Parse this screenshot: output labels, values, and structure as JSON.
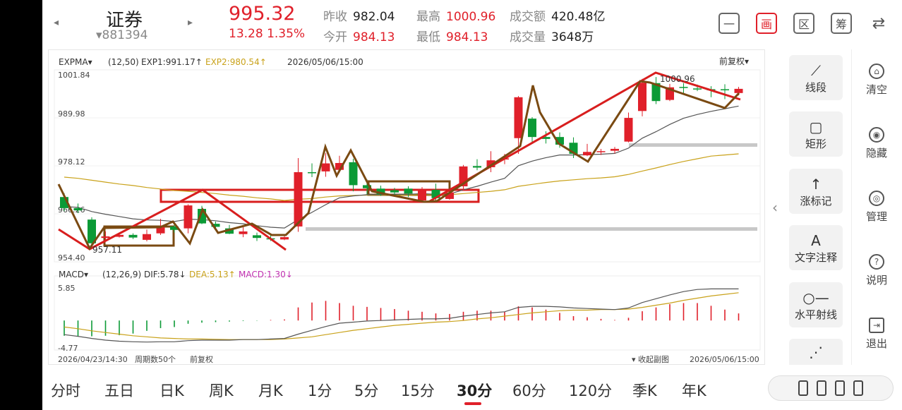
{
  "header": {
    "prev_arrow": "◂",
    "next_arrow": "▸",
    "name": "证券",
    "code": "▾881394",
    "price": "995.32",
    "change": "13.28  1.35%",
    "quotes": [
      {
        "label": "昨收",
        "value": "982.04",
        "color": "dark"
      },
      {
        "label": "最高",
        "value": "1000.96",
        "color": "red"
      },
      {
        "label": "成交额",
        "value": "420.48亿",
        "color": "dark"
      },
      {
        "label": "今开",
        "value": "984.13",
        "color": "red"
      },
      {
        "label": "最低",
        "value": "984.13",
        "color": "red"
      },
      {
        "label": "成交量",
        "value": "3648万",
        "color": "dark"
      }
    ],
    "tools": [
      {
        "icon": "minus-box-icon",
        "glyph": "一"
      },
      {
        "icon": "draw-icon",
        "glyph": "画"
      },
      {
        "icon": "range-icon",
        "glyph": "区"
      },
      {
        "icon": "chips-icon",
        "glyph": "筹"
      },
      {
        "icon": "rotate-phone-icon",
        "glyph": "⇄"
      }
    ]
  },
  "main_chart": {
    "indicator": "EXPMA▾",
    "params": "(12,50)",
    "exp1": "EXP1:991.17↑",
    "exp2": "EXP2:980.54↑",
    "datetime": "2026/05/06/15:00",
    "adjust": "前复权▾",
    "ticks": [
      "1001.84",
      "989.98",
      "978.12",
      "966.26",
      "954.40"
    ],
    "high_label": "1000.96",
    "low_label": "957.11"
  },
  "macd": {
    "indicator": "MACD▾",
    "params": "(12,26,9)",
    "dif": "DIF:5.78↓",
    "dea": "DEA:5.13↑",
    "macd": "MACD:1.30↓",
    "top": "5.85",
    "bottom": "-4.77"
  },
  "footer": {
    "start": "2026/04/23/14:30",
    "count": "周期数50个",
    "adjust": "前复权",
    "collapse": "▾ 收起副图",
    "end": "2026/05/06/15:00"
  },
  "colors": {
    "up": "#e0202a",
    "down": "#0b9a36",
    "exp1": "#555555",
    "exp2": "#c9a21a",
    "trend_brown": "#7a4a12"
  },
  "right_panel": {
    "collapse": "‹",
    "draw_tools": [
      {
        "icon": "segment-icon",
        "glyph": "⟋",
        "label": "线段"
      },
      {
        "icon": "rectangle-icon",
        "glyph": "▢",
        "label": "矩形"
      },
      {
        "icon": "up-mark-icon",
        "glyph": "↑",
        "label": "涨标记"
      },
      {
        "icon": "text-icon",
        "glyph": "A",
        "label": "文字注释"
      },
      {
        "icon": "ray-icon",
        "glyph": "○—",
        "label": "水平射线"
      },
      {
        "icon": "more-icon",
        "glyph": "⋰",
        "label": ""
      }
    ],
    "side_tools": [
      {
        "icon": "trash-icon",
        "glyph": "⌂",
        "label": "清空"
      },
      {
        "icon": "eye-icon",
        "glyph": "◉",
        "label": "隐藏"
      },
      {
        "icon": "settings-icon",
        "glyph": "◎",
        "label": "管理"
      },
      {
        "icon": "help-icon",
        "glyph": "?",
        "label": "说明"
      },
      {
        "icon": "exit-icon",
        "glyph": "⇥",
        "label": "退出"
      }
    ]
  },
  "periods": [
    "分时",
    "五日",
    "日K",
    "周K",
    "月K",
    "1分",
    "5分",
    "15分",
    "30分",
    "60分",
    "120分",
    "季K",
    "年K"
  ],
  "active_period": "30分",
  "chart_data": {
    "type": "candlestick",
    "ylim": [
      954.4,
      1001.84
    ],
    "candles": [
      {
        "o": 969.5,
        "c": 966.6,
        "h": 970.5,
        "l": 965.8
      },
      {
        "o": 966.6,
        "c": 966.0,
        "h": 967.8,
        "l": 965.3
      },
      {
        "o": 963.6,
        "c": 957.4,
        "h": 964.2,
        "l": 957.1
      },
      {
        "o": 958.8,
        "c": 959.2,
        "h": 960.5,
        "l": 958.1
      },
      {
        "o": 959.1,
        "c": 959.6,
        "h": 960.2,
        "l": 958.9
      },
      {
        "o": 959.6,
        "c": 958.9,
        "h": 960.0,
        "l": 958.5
      },
      {
        "o": 958.3,
        "c": 959.8,
        "h": 961.0,
        "l": 957.9
      },
      {
        "o": 960.0,
        "c": 961.6,
        "h": 963.8,
        "l": 959.6
      },
      {
        "o": 961.8,
        "c": 960.9,
        "h": 962.3,
        "l": 960.2
      },
      {
        "o": 961.3,
        "c": 967.3,
        "h": 967.6,
        "l": 960.0
      },
      {
        "o": 966.4,
        "c": 962.6,
        "h": 967.2,
        "l": 962.4
      },
      {
        "o": 962.5,
        "c": 961.7,
        "h": 963.1,
        "l": 960.8
      },
      {
        "o": 961.3,
        "c": 959.9,
        "h": 962.2,
        "l": 959.8
      },
      {
        "o": 959.8,
        "c": 960.5,
        "h": 961.9,
        "l": 959.0
      },
      {
        "o": 959.5,
        "c": 958.8,
        "h": 960.2,
        "l": 958.0
      },
      {
        "o": 958.7,
        "c": 958.5,
        "h": 959.9,
        "l": 958.0
      },
      {
        "o": 958.4,
        "c": 959.0,
        "h": 959.4,
        "l": 958.2
      },
      {
        "o": 961.8,
        "c": 976.0,
        "h": 979.7,
        "l": 960.4
      },
      {
        "o": 976.0,
        "c": 975.9,
        "h": 978.3,
        "l": 974.7
      },
      {
        "o": 976.2,
        "c": 978.3,
        "h": 981.0,
        "l": 974.8
      },
      {
        "o": 976.6,
        "c": 978.4,
        "h": 980.3,
        "l": 975.9
      },
      {
        "o": 978.6,
        "c": 972.6,
        "h": 979.5,
        "l": 971.0
      },
      {
        "o": 972.6,
        "c": 971.8,
        "h": 974.1,
        "l": 970.2
      },
      {
        "o": 971.7,
        "c": 970.2,
        "h": 972.5,
        "l": 969.8
      },
      {
        "o": 971.3,
        "c": 970.7,
        "h": 971.9,
        "l": 969.8
      },
      {
        "o": 971.7,
        "c": 970.4,
        "h": 972.3,
        "l": 969.5
      },
      {
        "o": 968.6,
        "c": 971.4,
        "h": 972.1,
        "l": 968.2
      },
      {
        "o": 971.4,
        "c": 969.2,
        "h": 973.0,
        "l": 968.4
      },
      {
        "o": 969.0,
        "c": 970.7,
        "h": 971.7,
        "l": 968.8
      },
      {
        "o": 972.3,
        "c": 977.5,
        "h": 977.9,
        "l": 971.3
      },
      {
        "o": 977.6,
        "c": 977.2,
        "h": 979.4,
        "l": 976.5
      },
      {
        "o": 977.3,
        "c": 979.1,
        "h": 981.5,
        "l": 976.0
      },
      {
        "o": 979.4,
        "c": 979.6,
        "h": 980.8,
        "l": 978.1
      },
      {
        "o": 984.9,
        "c": 995.6,
        "h": 995.9,
        "l": 980.8
      },
      {
        "o": 990.0,
        "c": 985.2,
        "h": 990.4,
        "l": 983.4
      },
      {
        "o": 985.2,
        "c": 984.7,
        "h": 986.7,
        "l": 983.5
      },
      {
        "o": 985.2,
        "c": 983.2,
        "h": 986.4,
        "l": 982.4
      },
      {
        "o": 983.7,
        "c": 980.8,
        "h": 985.1,
        "l": 979.7
      },
      {
        "o": 980.4,
        "c": 981.3,
        "h": 983.4,
        "l": 980.2
      },
      {
        "o": 981.3,
        "c": 981.5,
        "h": 982.1,
        "l": 980.5
      },
      {
        "o": 981.6,
        "c": 982.1,
        "h": 982.6,
        "l": 980.9
      },
      {
        "o": 984.0,
        "c": 990.2,
        "h": 991.6,
        "l": 983.8
      },
      {
        "o": 992.0,
        "c": 999.4,
        "h": 1000.4,
        "l": 990.6
      },
      {
        "o": 999.3,
        "c": 994.6,
        "h": 1000.9,
        "l": 993.8
      },
      {
        "o": 994.9,
        "c": 998.2,
        "h": 999.1,
        "l": 994.6
      },
      {
        "o": 998.3,
        "c": 998.2,
        "h": 999.3,
        "l": 996.5
      },
      {
        "o": 997.9,
        "c": 997.7,
        "h": 998.9,
        "l": 997.2
      },
      {
        "o": 997.7,
        "c": 997.5,
        "h": 998.5,
        "l": 995.6
      },
      {
        "o": 997.7,
        "c": 997.5,
        "h": 999.0,
        "l": 995.1
      },
      {
        "o": 996.7,
        "c": 997.8,
        "h": 998.3,
        "l": 996.1
      }
    ],
    "exp1": [
      967.0,
      966.8,
      965.7,
      965.0,
      964.4,
      963.8,
      963.5,
      963.4,
      963.1,
      963.7,
      963.6,
      963.3,
      962.8,
      962.5,
      962.0,
      961.6,
      961.4,
      963.6,
      965.5,
      967.5,
      969.3,
      969.8,
      970.1,
      970.1,
      970.2,
      970.2,
      970.4,
      970.2,
      970.3,
      971.4,
      972.3,
      973.4,
      974.4,
      977.7,
      978.9,
      979.8,
      980.5,
      980.5,
      980.6,
      980.7,
      980.9,
      982.3,
      984.9,
      986.6,
      988.5,
      990.1,
      991.1,
      991.9,
      992.6,
      993.3
    ],
    "exp2": [
      974.7,
      974.4,
      973.9,
      973.4,
      972.9,
      972.5,
      972.0,
      971.6,
      971.2,
      971.0,
      970.7,
      970.4,
      970.0,
      969.7,
      969.3,
      969.0,
      968.6,
      968.9,
      969.1,
      969.5,
      969.8,
      969.9,
      970.0,
      970.0,
      970.0,
      970.0,
      970.1,
      970.0,
      970.1,
      970.4,
      970.7,
      971.0,
      971.4,
      972.3,
      972.8,
      973.3,
      973.7,
      974.0,
      974.3,
      974.5,
      974.8,
      975.4,
      976.3,
      977.1,
      978.0,
      978.8,
      979.5,
      980.2,
      980.5,
      980.8
    ],
    "macd_ylim": [
      -4.77,
      5.85
    ],
    "dif": [
      -2.6,
      -2.9,
      -3.3,
      -3.6,
      -3.8,
      -3.9,
      -3.95,
      -3.9,
      -3.9,
      -3.7,
      -3.6,
      -3.6,
      -3.6,
      -3.5,
      -3.5,
      -3.4,
      -3.3,
      -2.5,
      -1.8,
      -1.1,
      -0.5,
      -0.3,
      -0.1,
      0.0,
      0.1,
      0.2,
      0.3,
      0.3,
      0.4,
      0.8,
      1.1,
      1.4,
      1.6,
      2.4,
      2.6,
      2.6,
      2.5,
      2.3,
      2.2,
      2.1,
      2.0,
      2.3,
      3.3,
      4.0,
      4.7,
      5.3,
      5.7,
      5.8,
      5.8,
      5.8
    ],
    "dea": [
      -1.2,
      -1.5,
      -1.9,
      -2.2,
      -2.5,
      -2.8,
      -3.0,
      -3.2,
      -3.3,
      -3.4,
      -3.4,
      -3.45,
      -3.5,
      -3.5,
      -3.5,
      -3.5,
      -3.4,
      -3.2,
      -3.0,
      -2.6,
      -2.2,
      -1.8,
      -1.5,
      -1.2,
      -0.9,
      -0.7,
      -0.5,
      -0.3,
      -0.2,
      0.0,
      0.3,
      0.5,
      0.8,
      1.1,
      1.4,
      1.6,
      1.8,
      1.9,
      1.9,
      2.0,
      2.0,
      2.1,
      2.4,
      2.8,
      3.2,
      3.7,
      4.1,
      4.5,
      4.8,
      5.1
    ],
    "hist": [
      -2.8,
      -2.9,
      -2.9,
      -2.8,
      -2.7,
      -2.4,
      -1.9,
      -1.4,
      -1.2,
      -0.6,
      -0.4,
      -0.3,
      -0.2,
      -0.1,
      -0.05,
      0.1,
      0.2,
      2.4,
      3.3,
      3.6,
      3.2,
      2.7,
      2.5,
      2.3,
      2.1,
      1.8,
      1.6,
      1.3,
      1.2,
      1.6,
      1.8,
      1.8,
      1.6,
      2.6,
      2.4,
      2.0,
      1.4,
      0.8,
      0.6,
      0.3,
      0.1,
      0.5,
      1.7,
      2.4,
      3.0,
      3.2,
      3.2,
      2.7,
      2.0,
      1.3
    ]
  }
}
